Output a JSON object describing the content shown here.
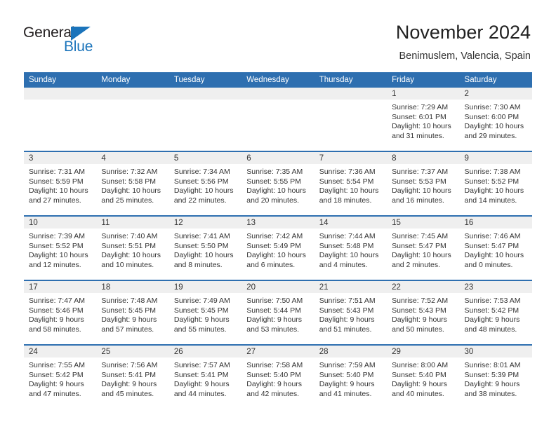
{
  "brand": {
    "logo_text_1": "General",
    "logo_text_2": "Blue",
    "logo_blue": "#1b74bb",
    "logo_dark": "#231f20"
  },
  "header": {
    "title": "November 2024",
    "subtitle": "Benimuslem, Valencia, Spain"
  },
  "theme": {
    "header_blue": "#2e6fb0",
    "date_band_gray": "#efefef",
    "body_text": "#333333"
  },
  "weekday_headers": [
    "Sunday",
    "Monday",
    "Tuesday",
    "Wednesday",
    "Thursday",
    "Friday",
    "Saturday"
  ],
  "labels": {
    "sunrise_prefix": "Sunrise:",
    "sunset_prefix": "Sunset:",
    "daylight_prefix": "Daylight:"
  },
  "weeks": [
    [
      {
        "date": "",
        "empty": true
      },
      {
        "date": "",
        "empty": true
      },
      {
        "date": "",
        "empty": true
      },
      {
        "date": "",
        "empty": true
      },
      {
        "date": "",
        "empty": true
      },
      {
        "date": "1",
        "sunrise": "Sunrise: 7:29 AM",
        "sunset": "Sunset: 6:01 PM",
        "daylight": "Daylight: 10 hours and 31 minutes."
      },
      {
        "date": "2",
        "sunrise": "Sunrise: 7:30 AM",
        "sunset": "Sunset: 6:00 PM",
        "daylight": "Daylight: 10 hours and 29 minutes."
      }
    ],
    [
      {
        "date": "3",
        "sunrise": "Sunrise: 7:31 AM",
        "sunset": "Sunset: 5:59 PM",
        "daylight": "Daylight: 10 hours and 27 minutes."
      },
      {
        "date": "4",
        "sunrise": "Sunrise: 7:32 AM",
        "sunset": "Sunset: 5:58 PM",
        "daylight": "Daylight: 10 hours and 25 minutes."
      },
      {
        "date": "5",
        "sunrise": "Sunrise: 7:34 AM",
        "sunset": "Sunset: 5:56 PM",
        "daylight": "Daylight: 10 hours and 22 minutes."
      },
      {
        "date": "6",
        "sunrise": "Sunrise: 7:35 AM",
        "sunset": "Sunset: 5:55 PM",
        "daylight": "Daylight: 10 hours and 20 minutes."
      },
      {
        "date": "7",
        "sunrise": "Sunrise: 7:36 AM",
        "sunset": "Sunset: 5:54 PM",
        "daylight": "Daylight: 10 hours and 18 minutes."
      },
      {
        "date": "8",
        "sunrise": "Sunrise: 7:37 AM",
        "sunset": "Sunset: 5:53 PM",
        "daylight": "Daylight: 10 hours and 16 minutes."
      },
      {
        "date": "9",
        "sunrise": "Sunrise: 7:38 AM",
        "sunset": "Sunset: 5:52 PM",
        "daylight": "Daylight: 10 hours and 14 minutes."
      }
    ],
    [
      {
        "date": "10",
        "sunrise": "Sunrise: 7:39 AM",
        "sunset": "Sunset: 5:52 PM",
        "daylight": "Daylight: 10 hours and 12 minutes."
      },
      {
        "date": "11",
        "sunrise": "Sunrise: 7:40 AM",
        "sunset": "Sunset: 5:51 PM",
        "daylight": "Daylight: 10 hours and 10 minutes."
      },
      {
        "date": "12",
        "sunrise": "Sunrise: 7:41 AM",
        "sunset": "Sunset: 5:50 PM",
        "daylight": "Daylight: 10 hours and 8 minutes."
      },
      {
        "date": "13",
        "sunrise": "Sunrise: 7:42 AM",
        "sunset": "Sunset: 5:49 PM",
        "daylight": "Daylight: 10 hours and 6 minutes."
      },
      {
        "date": "14",
        "sunrise": "Sunrise: 7:44 AM",
        "sunset": "Sunset: 5:48 PM",
        "daylight": "Daylight: 10 hours and 4 minutes."
      },
      {
        "date": "15",
        "sunrise": "Sunrise: 7:45 AM",
        "sunset": "Sunset: 5:47 PM",
        "daylight": "Daylight: 10 hours and 2 minutes."
      },
      {
        "date": "16",
        "sunrise": "Sunrise: 7:46 AM",
        "sunset": "Sunset: 5:47 PM",
        "daylight": "Daylight: 10 hours and 0 minutes."
      }
    ],
    [
      {
        "date": "17",
        "sunrise": "Sunrise: 7:47 AM",
        "sunset": "Sunset: 5:46 PM",
        "daylight": "Daylight: 9 hours and 58 minutes."
      },
      {
        "date": "18",
        "sunrise": "Sunrise: 7:48 AM",
        "sunset": "Sunset: 5:45 PM",
        "daylight": "Daylight: 9 hours and 57 minutes."
      },
      {
        "date": "19",
        "sunrise": "Sunrise: 7:49 AM",
        "sunset": "Sunset: 5:45 PM",
        "daylight": "Daylight: 9 hours and 55 minutes."
      },
      {
        "date": "20",
        "sunrise": "Sunrise: 7:50 AM",
        "sunset": "Sunset: 5:44 PM",
        "daylight": "Daylight: 9 hours and 53 minutes."
      },
      {
        "date": "21",
        "sunrise": "Sunrise: 7:51 AM",
        "sunset": "Sunset: 5:43 PM",
        "daylight": "Daylight: 9 hours and 51 minutes."
      },
      {
        "date": "22",
        "sunrise": "Sunrise: 7:52 AM",
        "sunset": "Sunset: 5:43 PM",
        "daylight": "Daylight: 9 hours and 50 minutes."
      },
      {
        "date": "23",
        "sunrise": "Sunrise: 7:53 AM",
        "sunset": "Sunset: 5:42 PM",
        "daylight": "Daylight: 9 hours and 48 minutes."
      }
    ],
    [
      {
        "date": "24",
        "sunrise": "Sunrise: 7:55 AM",
        "sunset": "Sunset: 5:42 PM",
        "daylight": "Daylight: 9 hours and 47 minutes."
      },
      {
        "date": "25",
        "sunrise": "Sunrise: 7:56 AM",
        "sunset": "Sunset: 5:41 PM",
        "daylight": "Daylight: 9 hours and 45 minutes."
      },
      {
        "date": "26",
        "sunrise": "Sunrise: 7:57 AM",
        "sunset": "Sunset: 5:41 PM",
        "daylight": "Daylight: 9 hours and 44 minutes."
      },
      {
        "date": "27",
        "sunrise": "Sunrise: 7:58 AM",
        "sunset": "Sunset: 5:40 PM",
        "daylight": "Daylight: 9 hours and 42 minutes."
      },
      {
        "date": "28",
        "sunrise": "Sunrise: 7:59 AM",
        "sunset": "Sunset: 5:40 PM",
        "daylight": "Daylight: 9 hours and 41 minutes."
      },
      {
        "date": "29",
        "sunrise": "Sunrise: 8:00 AM",
        "sunset": "Sunset: 5:40 PM",
        "daylight": "Daylight: 9 hours and 40 minutes."
      },
      {
        "date": "30",
        "sunrise": "Sunrise: 8:01 AM",
        "sunset": "Sunset: 5:39 PM",
        "daylight": "Daylight: 9 hours and 38 minutes."
      }
    ]
  ]
}
